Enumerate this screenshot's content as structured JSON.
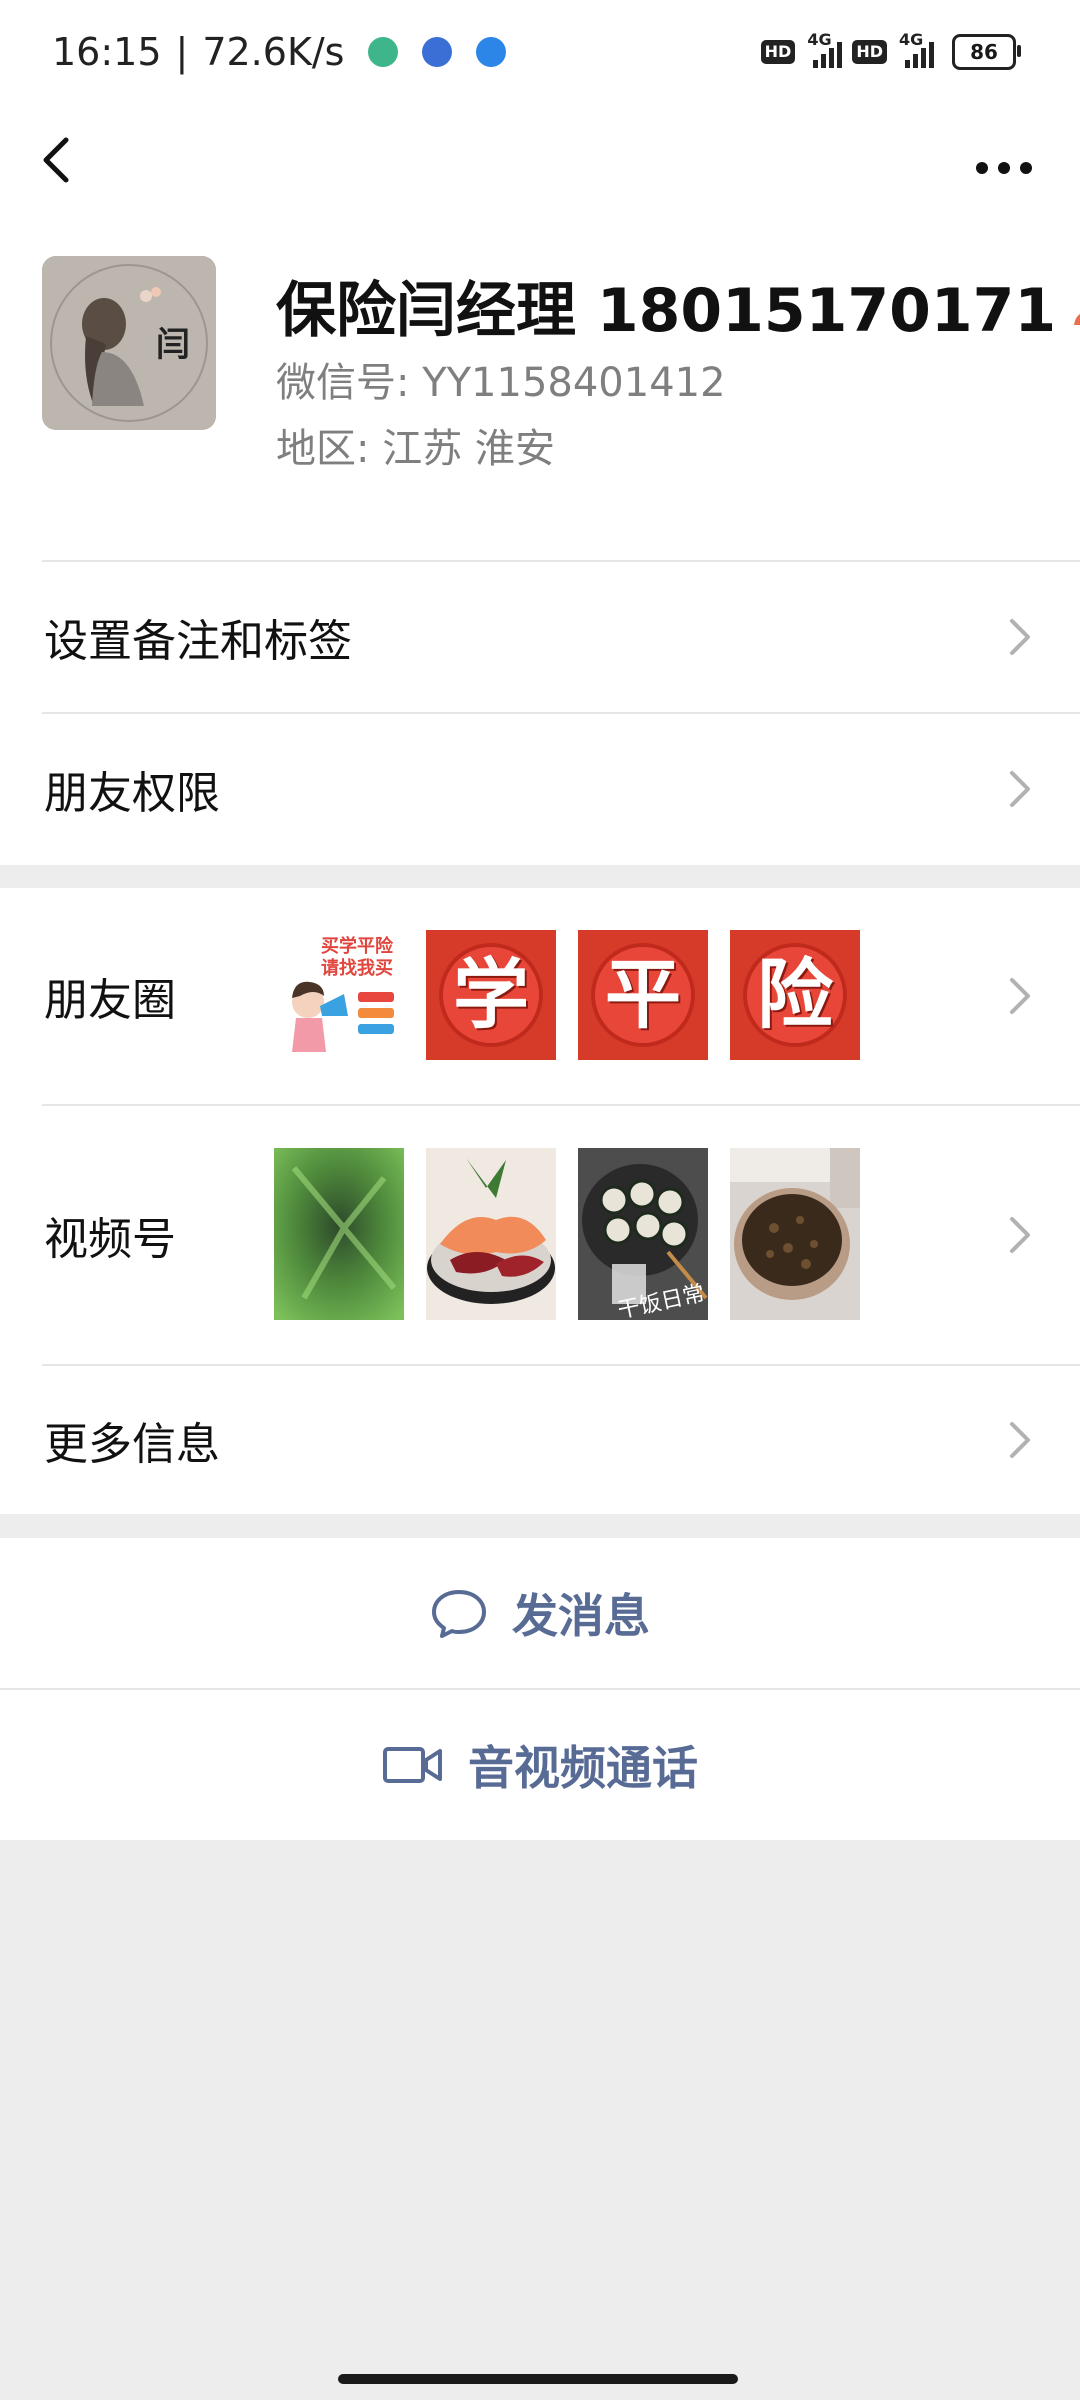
{
  "status_bar": {
    "time": "16:15",
    "separator": "|",
    "speed": "72.6K/s",
    "network1": "4G",
    "network2": "4G",
    "hd1": "HD",
    "hd2": "HD",
    "battery": "86"
  },
  "nav": {
    "back_icon": "chevron-left-icon",
    "more_icon": "more-dots-icon"
  },
  "profile": {
    "name": "保险闫经理 18015170171",
    "wechat_id": "微信号:  YY1158401412",
    "region": "地区:  江苏  淮安",
    "avatar_char": "闫",
    "badge_color": "#e8704f"
  },
  "menu": {
    "set_remark": "设置备注和标签",
    "permissions": "朋友权限",
    "moments": "朋友圈",
    "channels": "视频号",
    "more_info": "更多信息"
  },
  "moments_thumbs": {
    "poster_lines": "买学平险 请找我买",
    "chars": [
      "学",
      "平",
      "险"
    ]
  },
  "channel_thumbs": {
    "caption": "干饭日常"
  },
  "actions": {
    "message": "发消息",
    "call": "音视频通话",
    "accent_color": "#576b95"
  }
}
